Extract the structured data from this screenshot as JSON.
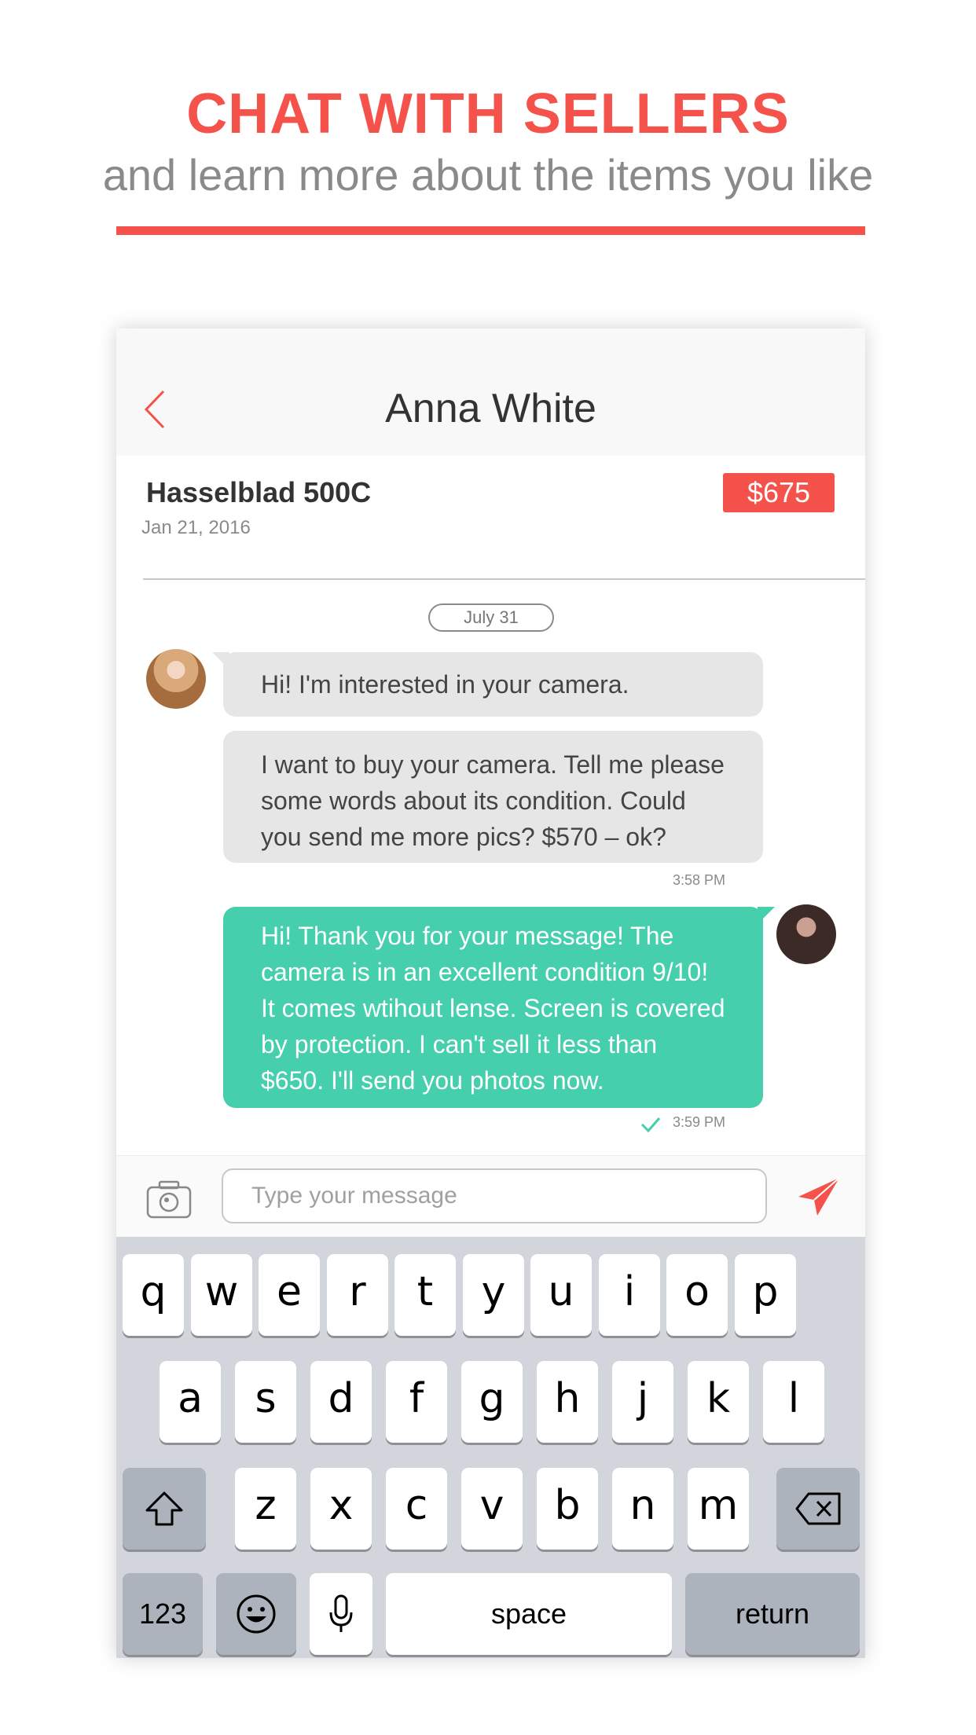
{
  "promo": {
    "headline": "CHAT WITH SELLERS",
    "subline": "and learn more about the items you like",
    "accent_color": "#f4524a"
  },
  "chat": {
    "nav": {
      "back_icon": "chevron-left-icon",
      "title": "Anna White"
    },
    "listing": {
      "product": "Hasselblad 500C",
      "date": "Jan 21, 2016",
      "price": "$675"
    },
    "date_separator": "July 31",
    "messages": [
      {
        "direction": "incoming",
        "text": "Hi! I'm interested in your camera."
      },
      {
        "direction": "incoming",
        "text": "I want to buy your camera. Tell me please some words about its condition. Could you send me more pics? $570 – ok?"
      },
      {
        "direction": "outgoing",
        "text": "Hi! Thank you for your message! The camera is in an excellent condition 9/10! It comes wtihout lense. Screen is covered by protection. I can't sell it less than $650. I'll send you photos now."
      }
    ],
    "times": {
      "incoming": "3:58 PM",
      "outgoing": "3:59 PM"
    },
    "outgoing_color": "#45cfad",
    "input": {
      "placeholder": "Type your message",
      "value": ""
    }
  },
  "keyboard": {
    "row1": [
      "q",
      "w",
      "e",
      "r",
      "t",
      "y",
      "u",
      "i",
      "o",
      "p"
    ],
    "row2": [
      "a",
      "s",
      "d",
      "f",
      "g",
      "h",
      "j",
      "k",
      "l"
    ],
    "row3": [
      "z",
      "x",
      "c",
      "v",
      "b",
      "n",
      "m"
    ],
    "numbers_label": "123",
    "space_label": "space",
    "return_label": "return"
  }
}
